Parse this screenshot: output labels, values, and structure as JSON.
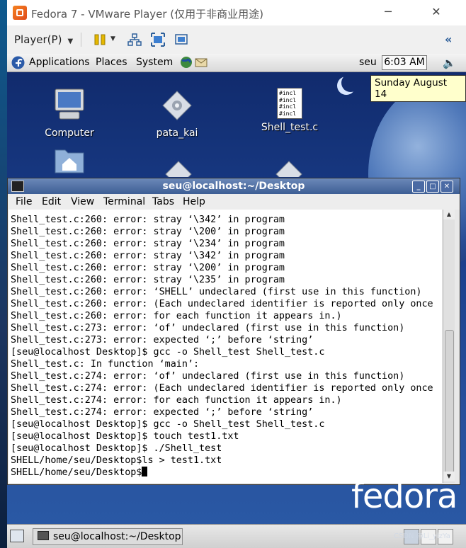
{
  "vmware": {
    "title": "Fedora 7 - VMware Player (仅用于非商业用途)",
    "player_menu": "Player(P)"
  },
  "guest_panel": {
    "applications": "Applications",
    "places": "Places",
    "system": "System",
    "user": "seu",
    "clock": "6:03 AM",
    "tooltip": "Sunday August 14"
  },
  "desktop_icons": [
    {
      "label": "Computer"
    },
    {
      "label": "pata_kai"
    },
    {
      "label": "Shell_test.c",
      "preview": "#incl"
    }
  ],
  "terminal": {
    "title": "seu@localhost:~/Desktop",
    "menu": [
      "File",
      "Edit",
      "View",
      "Terminal",
      "Tabs",
      "Help"
    ],
    "lines": [
      "Shell_test.c:260: error: stray ‘\\342’ in program",
      "Shell_test.c:260: error: stray ‘\\200’ in program",
      "Shell_test.c:260: error: stray ‘\\234’ in program",
      "Shell_test.c:260: error: stray ‘\\342’ in program",
      "Shell_test.c:260: error: stray ‘\\200’ in program",
      "Shell_test.c:260: error: stray ‘\\235’ in program",
      "Shell_test.c:260: error: ‘SHELL’ undeclared (first use in this function)",
      "Shell_test.c:260: error: (Each undeclared identifier is reported only once",
      "Shell_test.c:260: error: for each function it appears in.)",
      "Shell_test.c:273: error: ‘of’ undeclared (first use in this function)",
      "Shell_test.c:273: error: expected ‘;’ before ‘string’",
      "[seu@localhost Desktop]$ gcc -o Shell_test Shell_test.c",
      "Shell_test.c: In function ‘main’:",
      "Shell_test.c:274: error: ‘of’ undeclared (first use in this function)",
      "Shell_test.c:274: error: (Each undeclared identifier is reported only once",
      "Shell_test.c:274: error: for each function it appears in.)",
      "Shell_test.c:274: error: expected ‘;’ before ‘string’",
      "[seu@localhost Desktop]$ gcc -o Shell_test Shell_test.c",
      "[seu@localhost Desktop]$ touch test1.txt",
      "[seu@localhost Desktop]$ ./Shell_test",
      "SHELL/home/seu/Desktop$ls > test1.txt",
      "SHELL/home/seu/Desktop$"
    ]
  },
  "desktop_brand": "fedora",
  "taskbar": {
    "task": "seu@localhost:~/Desktop"
  },
  "watermark": "CSDN @Li_yizYa"
}
